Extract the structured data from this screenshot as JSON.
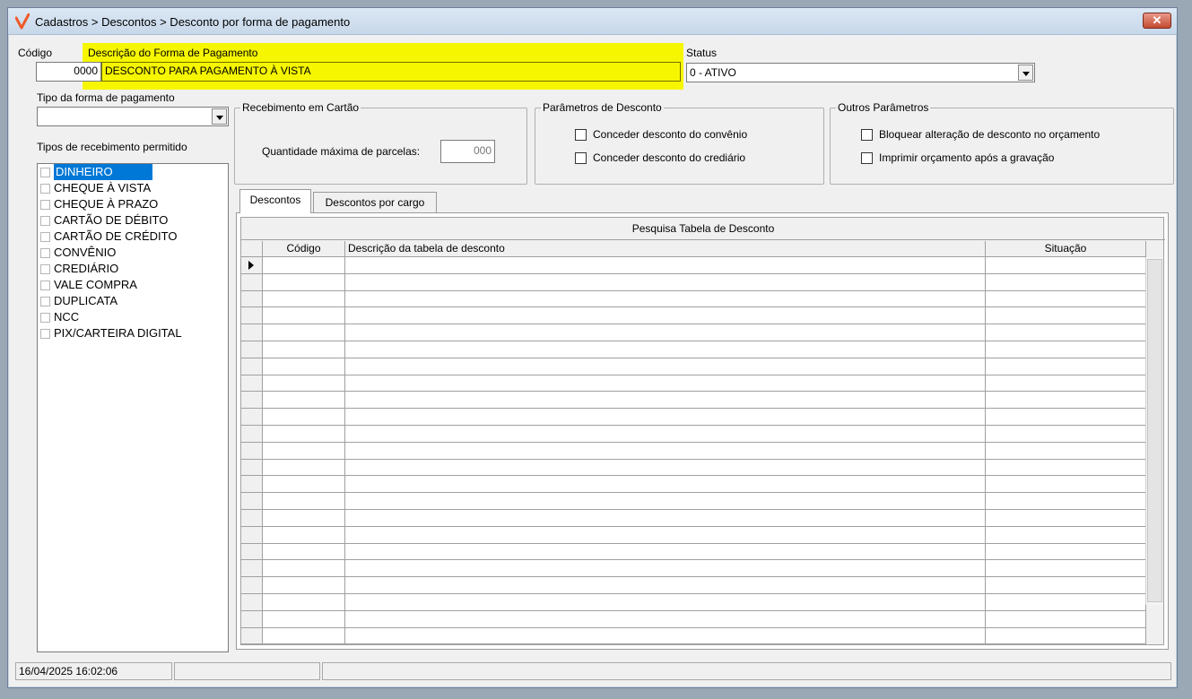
{
  "window": {
    "title": "Cadastros > Descontos > Desconto por forma de pagamento",
    "close_label": "✕",
    "accent_color": "#f05a28"
  },
  "form": {
    "codigo_label": "Código",
    "codigo_value": "0000",
    "descricao_label": "Descrição do Forma de Pagamento",
    "descricao_value": "DESCONTO PARA PAGAMENTO À VISTA",
    "status_label": "Status",
    "status_value": "0 - ATIVO",
    "tipo_label": "Tipo da forma de pagamento",
    "tipo_value": "",
    "tipos_receb_label": "Tipos de recebimento permitido"
  },
  "receb_types": [
    "DINHEIRO",
    "CHEQUE À VISTA",
    "CHEQUE À PRAZO",
    "CARTÃO DE DÉBITO",
    "CARTÃO DE CRÉDITO",
    "CONVÊNIO",
    "CREDIÁRIO",
    "VALE COMPRA",
    "DUPLICATA",
    "NCC",
    "PIX/CARTEIRA DIGITAL"
  ],
  "cartao": {
    "title": "Recebimento em Cartão",
    "parcelas_label": "Quantidade máxima de parcelas:",
    "parcelas_value": "000"
  },
  "param_desc": {
    "title": "Parâmetros de Desconto",
    "conv_label": "Conceder desconto do convênio",
    "cred_label": "Conceder desconto do crediário"
  },
  "outros": {
    "title": "Outros Parâmetros",
    "bloquear_label": "Bloquear alteração de desconto no orçamento",
    "imprimir_label": "Imprimir orçamento após a gravação"
  },
  "tabs": {
    "descontos": "Descontos",
    "por_cargo": "Descontos por cargo"
  },
  "grid": {
    "caption": "Pesquisa Tabela de Desconto",
    "col_codigo": "Código",
    "col_descricao": "Descrição da tabela de desconto",
    "col_situacao": "Situação"
  },
  "status_bar": {
    "datetime": "16/04/2025 16:02:06",
    "panel2": "",
    "panel3": ""
  }
}
